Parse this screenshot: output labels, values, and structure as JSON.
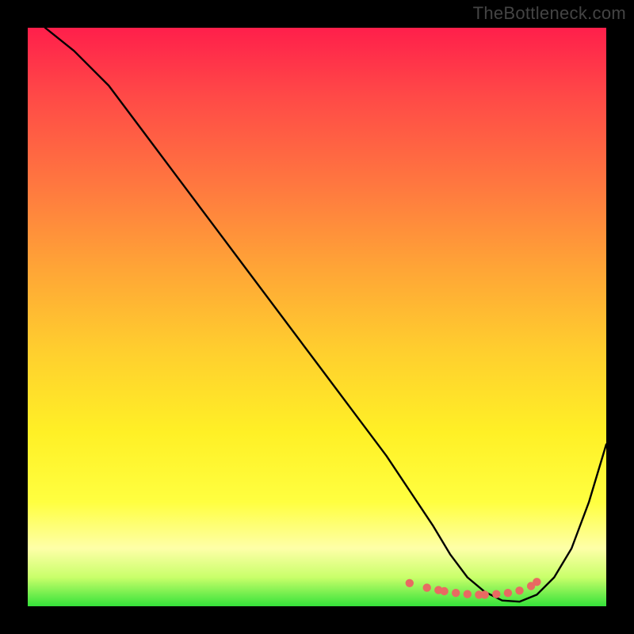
{
  "watermark": "TheBottleneck.com",
  "chart_data": {
    "type": "line",
    "title": "",
    "xlabel": "",
    "ylabel": "",
    "xlim": [
      0,
      100
    ],
    "ylim": [
      0,
      100
    ],
    "grid": false,
    "legend": false,
    "annotations": [],
    "series": [
      {
        "name": "curve",
        "color": "#000000",
        "x": [
          3,
          8,
          14,
          20,
          26,
          32,
          38,
          44,
          50,
          56,
          62,
          66,
          70,
          73,
          76,
          79,
          82,
          85,
          88,
          91,
          94,
          97,
          100
        ],
        "y": [
          100,
          96,
          90,
          82,
          74,
          66,
          58,
          50,
          42,
          34,
          26,
          20,
          14,
          9,
          5,
          2.5,
          1,
          0.8,
          2,
          5,
          10,
          18,
          28
        ]
      },
      {
        "name": "highlight-dots",
        "color": "#e86a62",
        "style": "markers",
        "x": [
          66,
          69,
          71,
          72,
          74,
          76,
          78,
          79,
          81,
          83,
          85,
          87,
          88
        ],
        "y": [
          4,
          3.2,
          2.8,
          2.6,
          2.3,
          2.1,
          2.0,
          2.0,
          2.1,
          2.3,
          2.7,
          3.5,
          4.2
        ]
      }
    ],
    "gradient_stops": [
      {
        "pos": 0,
        "color": "#ff1f4b"
      },
      {
        "pos": 12,
        "color": "#ff4a47"
      },
      {
        "pos": 28,
        "color": "#ff7a3f"
      },
      {
        "pos": 42,
        "color": "#ffa636"
      },
      {
        "pos": 56,
        "color": "#ffcf2e"
      },
      {
        "pos": 70,
        "color": "#fff026"
      },
      {
        "pos": 82,
        "color": "#ffff40"
      },
      {
        "pos": 90,
        "color": "#feffa8"
      },
      {
        "pos": 95,
        "color": "#c9ff6a"
      },
      {
        "pos": 100,
        "color": "#35e23a"
      }
    ]
  }
}
